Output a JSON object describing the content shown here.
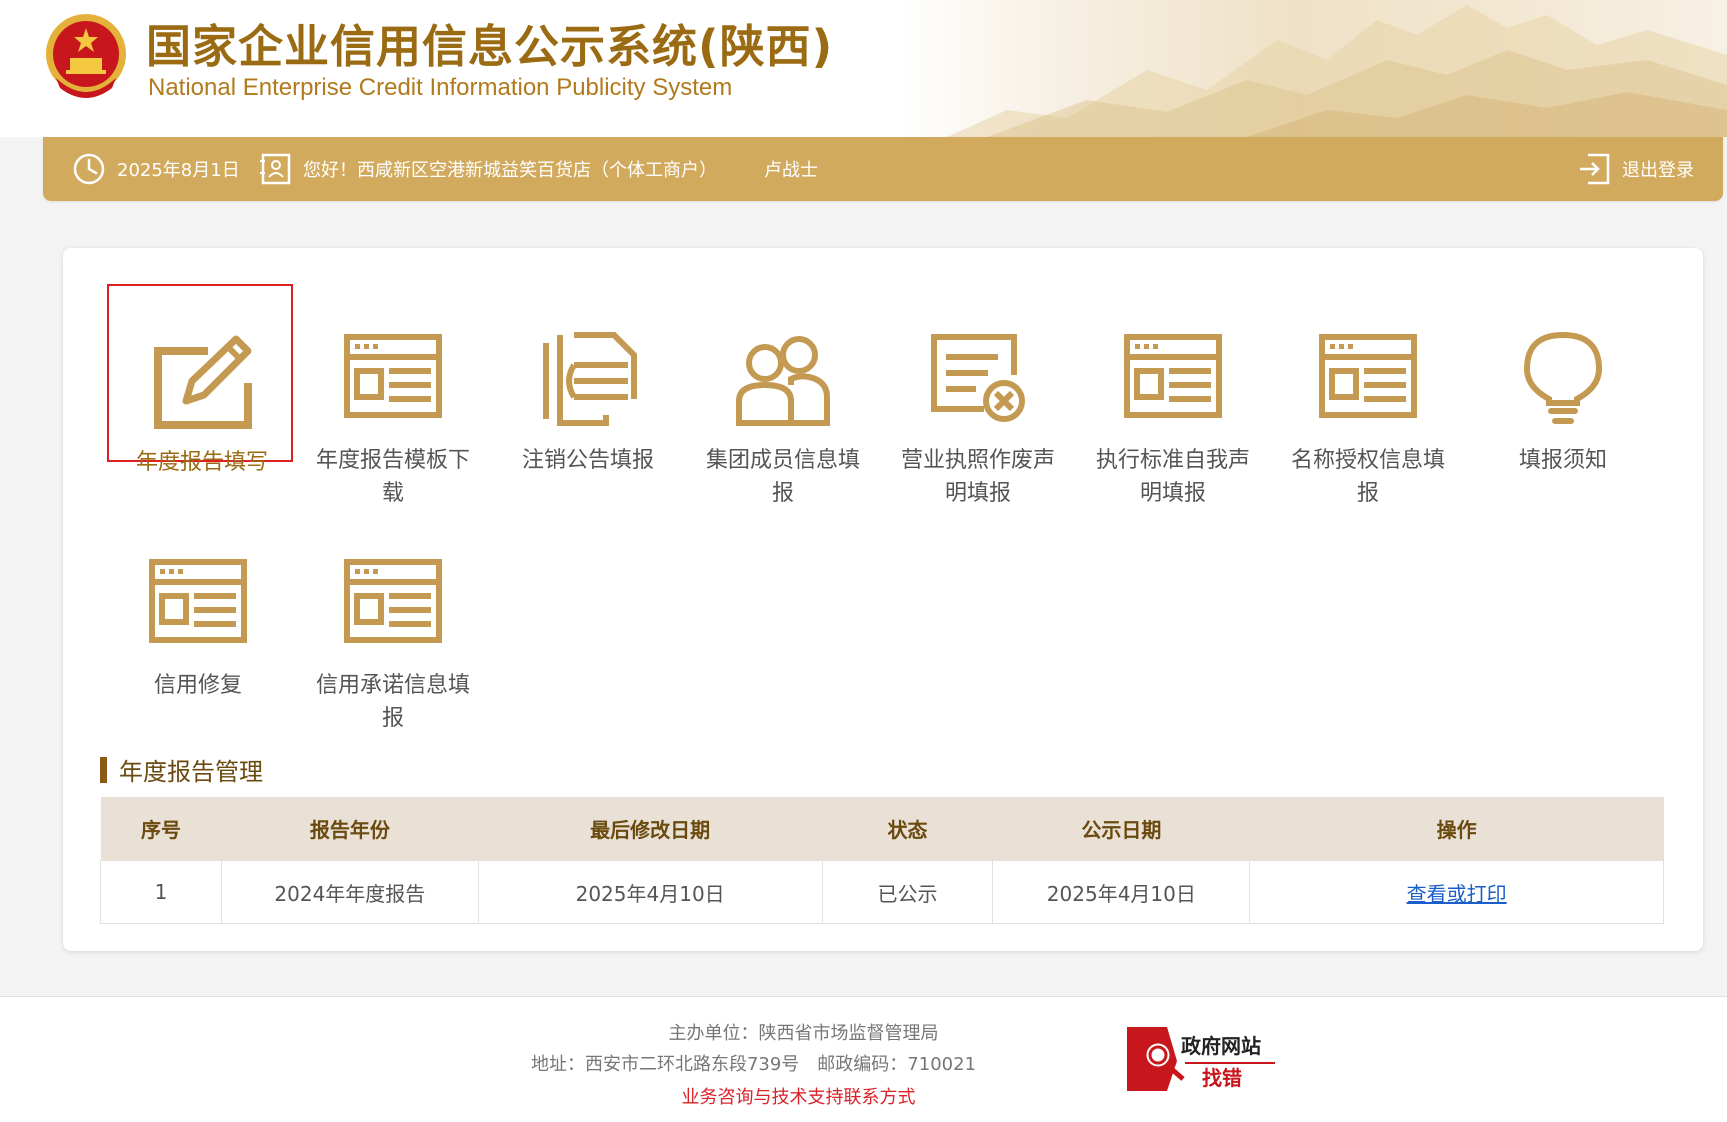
{
  "header": {
    "title_cn": "国家企业信用信息公示系统(陕西)",
    "title_en": "National Enterprise Credit Information Publicity System"
  },
  "userbar": {
    "date": "2025年8月1日",
    "greeting": "您好！西咸新区空港新城益笑百货店（个体工商户）",
    "person": "卢战士",
    "logout_label": "退出登录"
  },
  "menu": {
    "items": [
      {
        "label": "年度报告填写",
        "icon": "edit-pencil-icon",
        "selected": true
      },
      {
        "label": "年度报告模板下载",
        "icon": "form-template-icon"
      },
      {
        "label": "注销公告填报",
        "icon": "document-stack-icon"
      },
      {
        "label": "集团成员信息填报",
        "icon": "group-users-icon"
      },
      {
        "label": "营业执照作废声明填报",
        "icon": "license-void-icon"
      },
      {
        "label": "执行标准自我声明填报",
        "icon": "form-template-icon"
      },
      {
        "label": "名称授权信息填报",
        "icon": "form-template-icon"
      },
      {
        "label": "填报须知",
        "icon": "lightbulb-icon"
      },
      {
        "label": "信用修复",
        "icon": "form-template-icon"
      },
      {
        "label": "信用承诺信息填报",
        "icon": "form-template-icon"
      }
    ]
  },
  "report_section": {
    "title": "年度报告管理",
    "columns": [
      "序号",
      "报告年份",
      "最后修改日期",
      "状态",
      "公示日期",
      "操作"
    ],
    "rows": [
      {
        "index": "1",
        "year": "2024年年度报告",
        "modified": "2025年4月10日",
        "status": "已公示",
        "publish_date": "2025年4月10日",
        "action": "查看或打印"
      }
    ]
  },
  "footer": {
    "host": "主办单位：陕西省市场监督管理局",
    "address": "地址：西安市二环北路东段739号　邮政编码：710021",
    "support": "业务咨询与技术支持联系方式",
    "badge_line1": "政府网站",
    "badge_line2": "找错"
  },
  "colors": {
    "gold": "#d2aa5e",
    "brown": "#9a6b12",
    "selected_border": "#e02020",
    "link": "#1a5fc9",
    "table_header": "#eae1d6"
  }
}
